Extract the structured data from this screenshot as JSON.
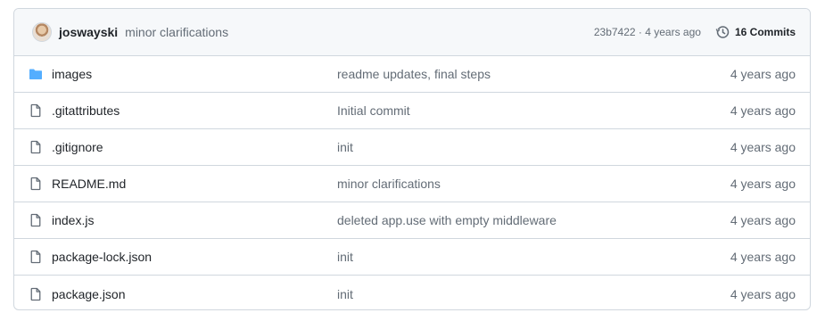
{
  "header": {
    "author": "joswayski",
    "message": "minor clarifications",
    "sha": "23b7422",
    "separator": " · ",
    "time": "4 years ago",
    "commits_label": "16 Commits",
    "history_icon": "history-icon"
  },
  "files": [
    {
      "name": "images",
      "icon": "folder-icon",
      "message": "readme updates, final steps",
      "time": "4 years ago"
    },
    {
      "name": ".gitattributes",
      "icon": "file-icon",
      "message": "Initial commit",
      "time": "4 years ago"
    },
    {
      "name": ".gitignore",
      "icon": "file-icon",
      "message": "init",
      "time": "4 years ago"
    },
    {
      "name": "README.md",
      "icon": "file-icon",
      "message": "minor clarifications",
      "time": "4 years ago"
    },
    {
      "name": "index.js",
      "icon": "file-icon",
      "message": "deleted app.use with empty middleware",
      "time": "4 years ago"
    },
    {
      "name": "package-lock.json",
      "icon": "file-icon",
      "message": "init",
      "time": "4 years ago"
    },
    {
      "name": "package.json",
      "icon": "file-icon",
      "message": "init",
      "time": "4 years ago"
    }
  ],
  "colors": {
    "folder": "#54aeff",
    "border": "#d0d7de",
    "header_bg": "#f6f8fa",
    "muted_text": "#636c76"
  }
}
